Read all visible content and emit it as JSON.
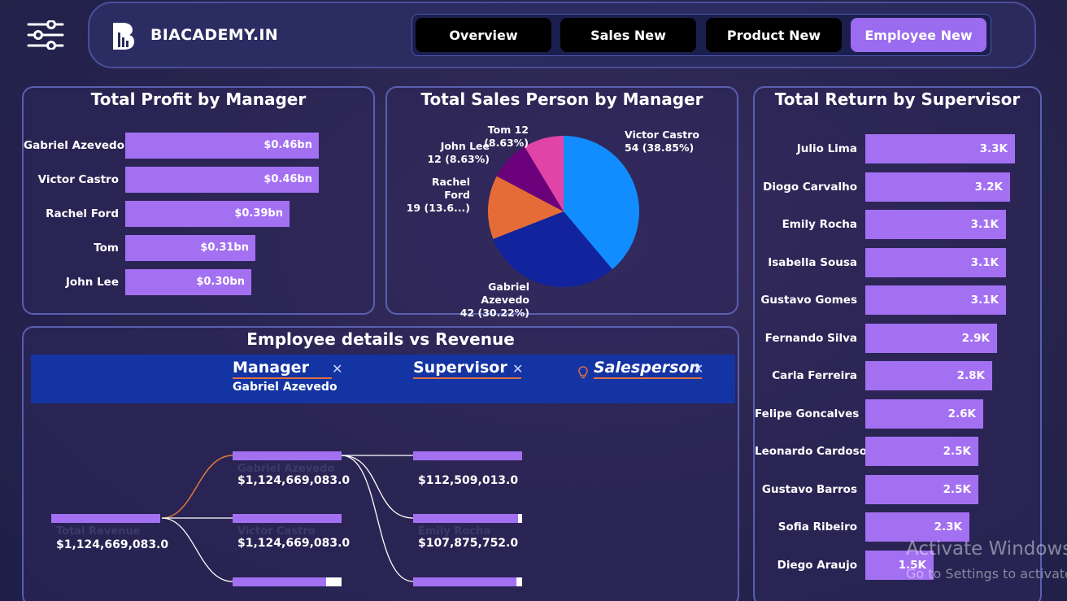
{
  "header": {
    "brand": "BIACADEMY.IN",
    "nav": [
      {
        "label": "Overview",
        "active": false
      },
      {
        "label": "Sales New",
        "active": false
      },
      {
        "label": "Product New",
        "active": false
      },
      {
        "label": "Employee New",
        "active": true
      }
    ]
  },
  "profit_by_manager": {
    "title": "Total Profit by Manager",
    "rows": [
      {
        "name": "Gabriel Azevedo",
        "value": 0.46,
        "label": "$0.46bn"
      },
      {
        "name": "Victor Castro",
        "value": 0.46,
        "label": "$0.46bn"
      },
      {
        "name": "Rachel Ford",
        "value": 0.39,
        "label": "$0.39bn"
      },
      {
        "name": "Tom",
        "value": 0.31,
        "label": "$0.31bn"
      },
      {
        "name": "John Lee",
        "value": 0.3,
        "label": "$0.30bn"
      }
    ]
  },
  "sales_person_by_manager": {
    "title": "Total Sales Person by Manager",
    "slices": [
      {
        "name": "Victor Castro",
        "value": 54,
        "label_line1": "Victor Castro",
        "label_line2": "54 (38.85%)",
        "color": "#118dff"
      },
      {
        "name": "Gabriel Azevedo",
        "value": 42,
        "label_line1": "Gabriel Azevedo",
        "label_line2": "42 (30.22%)",
        "color": "#12239e"
      },
      {
        "name": "Rachel Ford",
        "value": 19,
        "label_line1": "Rachel Ford",
        "label_line2": "19 (13.6...)",
        "color": "#e66c37"
      },
      {
        "name": "John Lee",
        "value": 12,
        "label_line1": "John Lee",
        "label_line2": "12 (8.63%)",
        "color": "#6b007b"
      },
      {
        "name": "Tom",
        "value": 12,
        "label_line1": "Tom 12 (8.63%)",
        "label_line2": "",
        "color": "#e044a7"
      }
    ]
  },
  "return_by_supervisor": {
    "title": "Total Return by Supervisor",
    "rows": [
      {
        "name": "Julio Lima",
        "value": 3.3,
        "label": "3.3K"
      },
      {
        "name": "Diogo Carvalho",
        "value": 3.2,
        "label": "3.2K"
      },
      {
        "name": "Emily Rocha",
        "value": 3.1,
        "label": "3.1K"
      },
      {
        "name": "Isabella Sousa",
        "value": 3.1,
        "label": "3.1K"
      },
      {
        "name": "Gustavo Gomes",
        "value": 3.1,
        "label": "3.1K"
      },
      {
        "name": "Fernando Silva",
        "value": 2.9,
        "label": "2.9K"
      },
      {
        "name": "Carla Ferreira",
        "value": 2.8,
        "label": "2.8K"
      },
      {
        "name": "Felipe Goncalves",
        "value": 2.6,
        "label": "2.6K"
      },
      {
        "name": "Leonardo Cardoso",
        "value": 2.5,
        "label": "2.5K"
      },
      {
        "name": "Gustavo Barros",
        "value": 2.5,
        "label": "2.5K"
      },
      {
        "name": "Sofia Ribeiro",
        "value": 2.3,
        "label": "2.3K"
      },
      {
        "name": "Diego Araujo",
        "value": 1.5,
        "label": "1.5K"
      }
    ]
  },
  "decomposition": {
    "title": "Employee details vs Revenue",
    "levels": {
      "manager": {
        "title": "Manager",
        "selected": "Gabriel Azevedo"
      },
      "supervisor": {
        "title": "Supervisor"
      },
      "salesperson": {
        "title": "Salesperson"
      }
    },
    "root": {
      "name": "Total Revenue",
      "value": "$1,124,669,083.0"
    },
    "manager_nodes": [
      {
        "name": "Gabriel Azevedo",
        "value": "$1,124,669,083.0",
        "fill": 1.0
      },
      {
        "name": "Victor Castro",
        "value": "$1,124,669,083.0",
        "fill": 1.0
      },
      {
        "name": "",
        "value": "",
        "fill": 0.86
      }
    ],
    "supervisor_nodes": [
      {
        "name": "",
        "value": "$112,509,013.0",
        "fill": 1.0
      },
      {
        "name": "Emily Rocha",
        "value": "$107,875,752.0",
        "fill": 0.96
      },
      {
        "name": "",
        "value": "",
        "fill": 0.95
      }
    ]
  },
  "watermark": {
    "line1": "Activate Windows",
    "line2": "Go to Settings to activate"
  }
}
